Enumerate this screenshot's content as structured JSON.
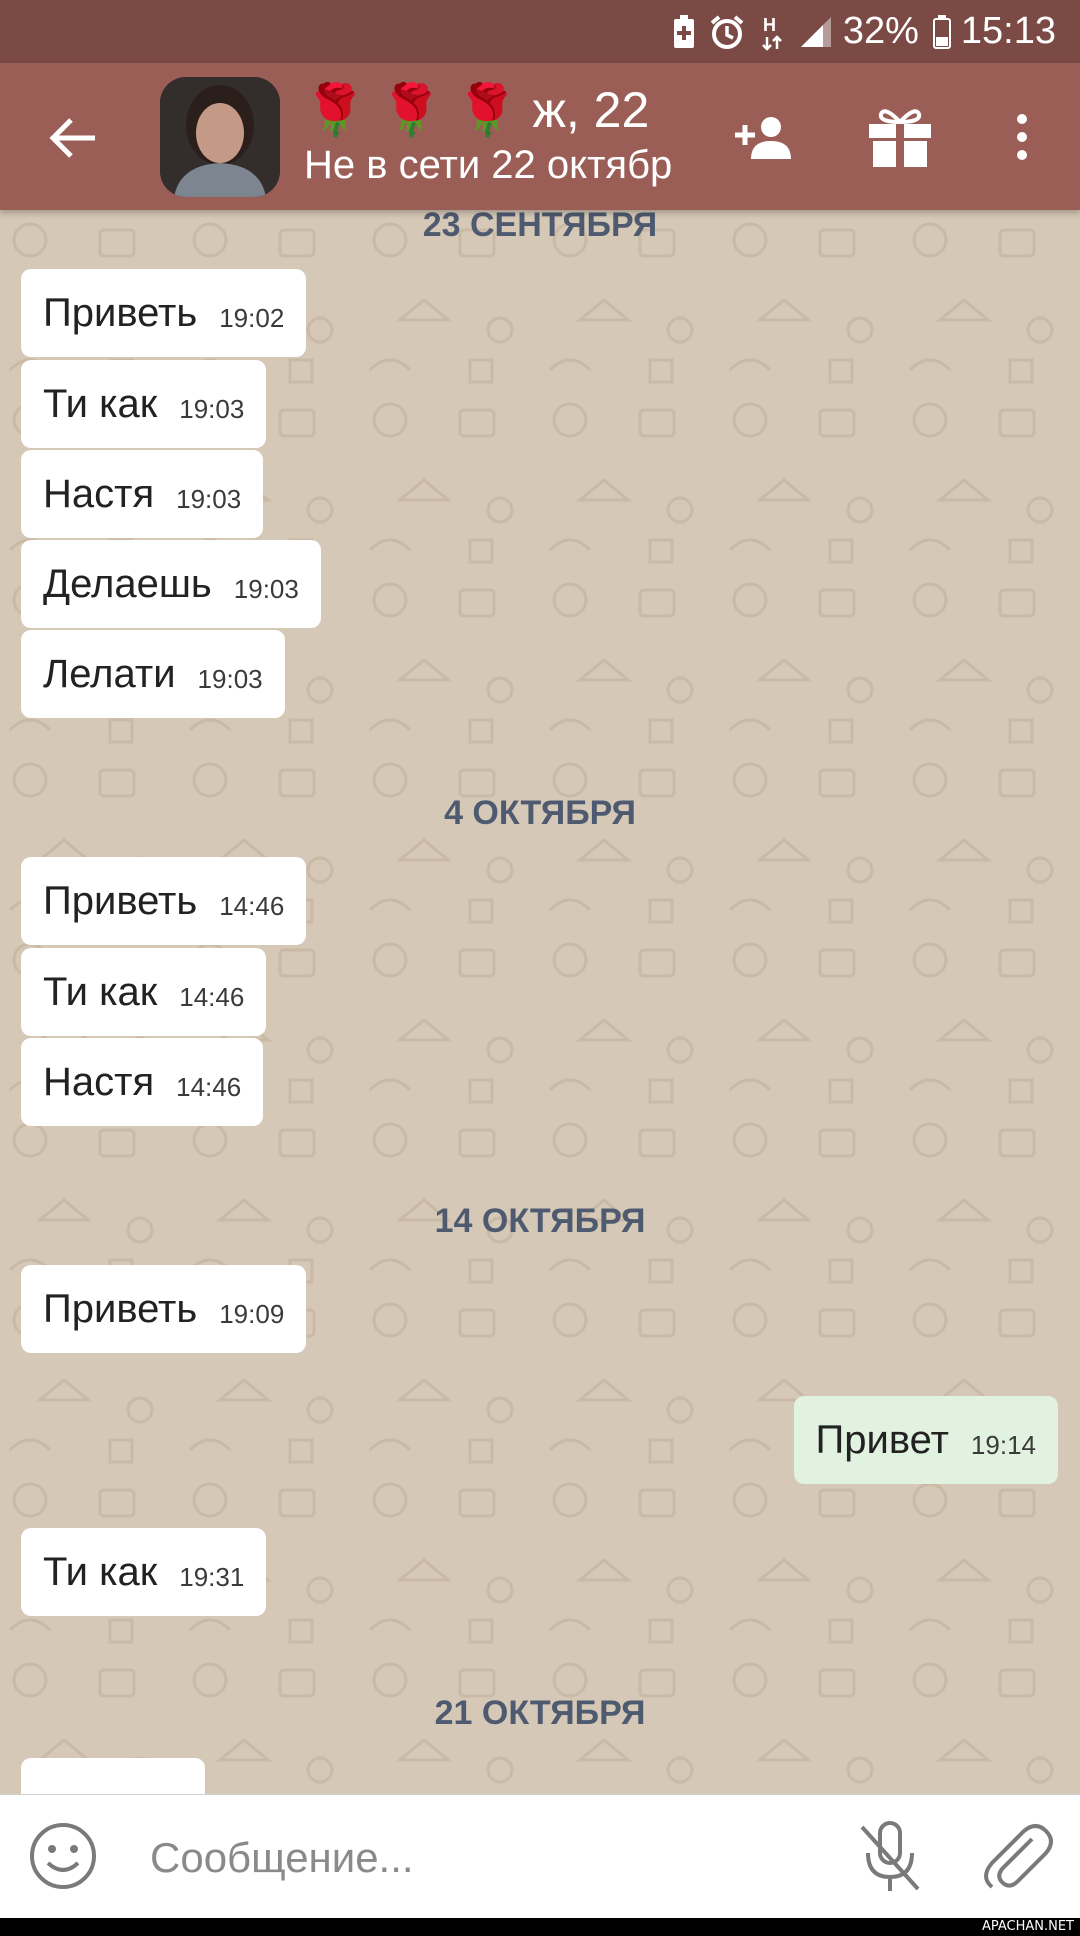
{
  "status_bar": {
    "battery_percent": "32%",
    "time": "15:13",
    "network": "H",
    "icons": [
      "battery-saver-icon",
      "alarm-icon",
      "network-h-icon",
      "signal-icon",
      "battery-icon"
    ]
  },
  "header": {
    "title": "🌹 🌹 🌹 ж, 22",
    "subtitle": "Не в сети 22 октябр",
    "colors": {
      "header": "#9b5e57",
      "status_bar": "#7b4a45"
    },
    "icons": [
      "back-arrow-icon",
      "add-contact-icon",
      "gift-icon",
      "more-vert-icon"
    ]
  },
  "chat": {
    "dates": [
      "23 СЕНТЯБРЯ",
      "4 ОКТЯБРЯ",
      "14 ОКТЯБРЯ",
      "21 ОКТЯБРЯ"
    ],
    "messages": [
      {
        "text": "Приветь",
        "time": "19:02",
        "direction": "in"
      },
      {
        "text": "Ти как",
        "time": "19:03",
        "direction": "in"
      },
      {
        "text": "Настя",
        "time": "19:03",
        "direction": "in"
      },
      {
        "text": "Делаешь",
        "time": "19:03",
        "direction": "in"
      },
      {
        "text": "Лелати",
        "time": "19:03",
        "direction": "in"
      },
      {
        "text": "Приветь",
        "time": "14:46",
        "direction": "in"
      },
      {
        "text": "Ти как",
        "time": "14:46",
        "direction": "in"
      },
      {
        "text": "Настя",
        "time": "14:46",
        "direction": "in"
      },
      {
        "text": "Приветь",
        "time": "19:09",
        "direction": "in"
      },
      {
        "text": "Привет",
        "time": "19:14",
        "direction": "out"
      },
      {
        "text": "Ти как",
        "time": "19:31",
        "direction": "in"
      }
    ],
    "colors": {
      "background": "#d6c8b6",
      "incoming": "#ffffff",
      "outgoing": "#e2f2e1",
      "date": "#4e5a70"
    }
  },
  "input": {
    "placeholder": "Сообщение...",
    "value": "",
    "icons": [
      "emoji-icon",
      "mic-off-icon",
      "attach-icon"
    ]
  },
  "watermark": "APACHAN.NET"
}
